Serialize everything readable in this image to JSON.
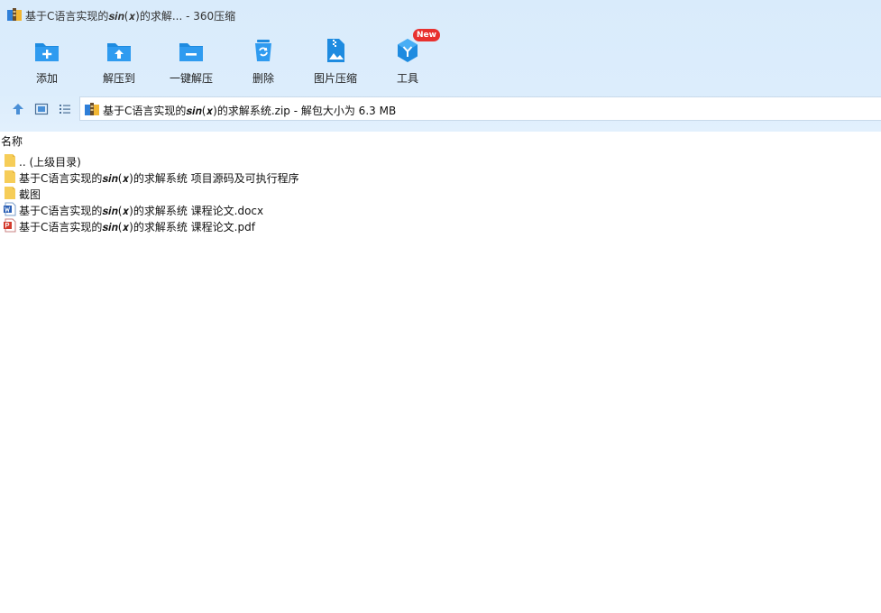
{
  "window": {
    "title": "基于C语言实现的𝒔𝒊𝒏(𝒙)的求解... - 360压缩"
  },
  "toolbar": {
    "items": [
      {
        "label": "添加",
        "icon": "folder-add-icon"
      },
      {
        "label": "解压到",
        "icon": "folder-extract-icon"
      },
      {
        "label": "一键解压",
        "icon": "folder-minus-icon"
      },
      {
        "label": "删除",
        "icon": "trash-icon"
      },
      {
        "label": "图片压缩",
        "icon": "image-zip-icon"
      },
      {
        "label": "工具",
        "icon": "tools-icon",
        "badge": "New"
      }
    ]
  },
  "address": {
    "text": "基于C语言实现的𝒔𝒊𝒏(𝒙)的求解系统.zip - 解包大小为 6.3 MB"
  },
  "list": {
    "column_header": "名称",
    "rows": [
      {
        "name": ".. (上级目录)",
        "icon": "folder-icon"
      },
      {
        "name": "基于C语言实现的𝒔𝒊𝒏(𝒙)的求解系统 项目源码及可执行程序",
        "icon": "folder-icon"
      },
      {
        "name": "截图",
        "icon": "folder-icon"
      },
      {
        "name": "基于C语言实现的𝒔𝒊𝒏(𝒙)的求解系统 课程论文.docx",
        "icon": "word-doc-icon"
      },
      {
        "name": "基于C语言实现的𝒔𝒊𝒏(𝒙)的求解系统 课程论文.pdf",
        "icon": "pdf-icon"
      }
    ]
  },
  "colors": {
    "accent": "#1e8be0",
    "folder": "#f6cd58",
    "badge": "#e8312f"
  }
}
